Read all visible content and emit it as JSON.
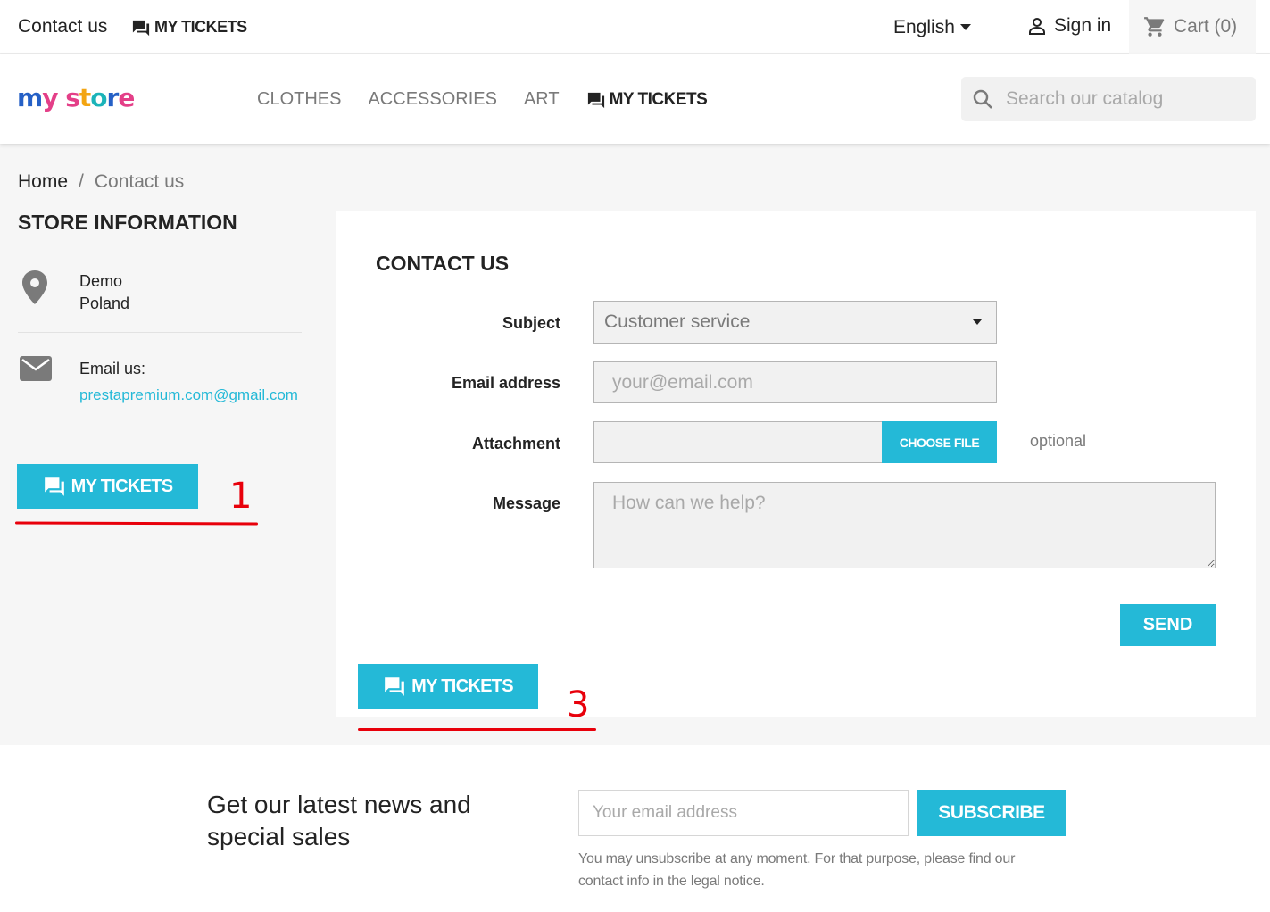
{
  "topbar": {
    "contact_label": "Contact us",
    "my_tickets_label": "MY TICKETS",
    "language": "English",
    "sign_in_label": "Sign in",
    "cart_label": "Cart (0)"
  },
  "header": {
    "logo_text": "my store",
    "nav": [
      "CLOTHES",
      "ACCESSORIES",
      "ART",
      "MY TICKETS"
    ],
    "search_placeholder": "Search our catalog"
  },
  "breadcrumb": [
    "Home",
    "/",
    "Contact us"
  ],
  "store_info": {
    "title": "STORE INFORMATION",
    "address_line1": "Demo",
    "address_line2": "Poland",
    "email_label": "Email us:",
    "email_value": "prestapremium.com@gmail.com",
    "my_tickets_button": "MY TICKETS"
  },
  "contact_form": {
    "title": "CONTACT US",
    "subject_label": "Subject",
    "subject_value": "Customer service",
    "email_label": "Email address",
    "email_placeholder": "your@email.com",
    "attachment_label": "Attachment",
    "choose_file_label": "CHOOSE FILE",
    "optional_label": "optional",
    "message_label": "Message",
    "message_placeholder": "How can we help?",
    "send_label": "SEND",
    "my_tickets_button": "MY TICKETS"
  },
  "annotations": {
    "marker_1": "1",
    "marker_3": "3",
    "color": "#e8000b"
  },
  "newsletter": {
    "title": "Get our latest news and special sales",
    "email_placeholder": "Your email address",
    "subscribe_label": "SUBSCRIBE",
    "note": "You may unsubscribe at any moment. For that purpose, please find our contact info in the legal notice."
  },
  "colors": {
    "accent": "#24b9d7",
    "page_bg": "#f6f6f6",
    "text": "#232323",
    "muted": "#7a7a7a"
  }
}
